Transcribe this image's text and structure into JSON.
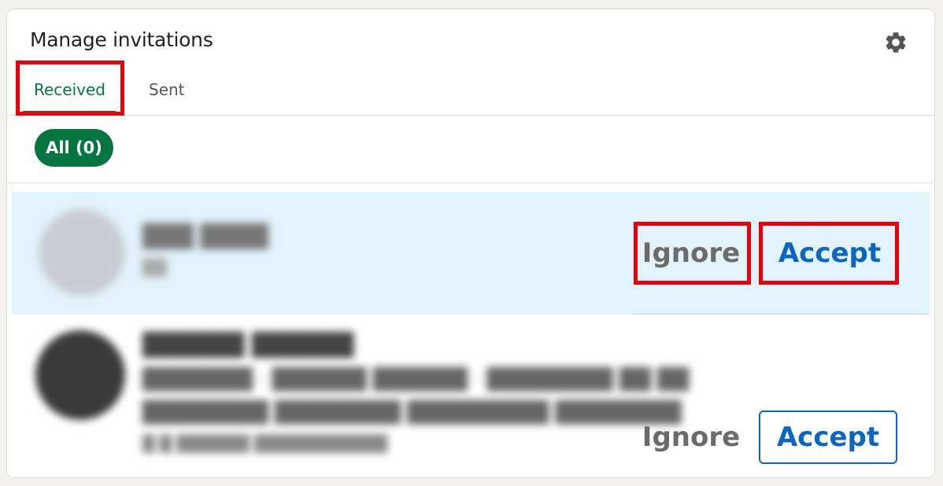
{
  "header": {
    "title": "Manage invitations",
    "settings_icon": "gear-icon"
  },
  "tabs": [
    {
      "label": "Received",
      "active": true
    },
    {
      "label": "Sent",
      "active": false
    }
  ],
  "filter": {
    "label": "All (0)"
  },
  "invitations": [
    {
      "ignore_label": "Ignore",
      "accept_label": "Accept",
      "highlighted": true
    },
    {
      "ignore_label": "Ignore",
      "accept_label": "Accept",
      "highlighted": false
    }
  ],
  "colors": {
    "accent_green": "#057642",
    "accept_blue": "#0a66c2",
    "highlight_red": "#e8000b",
    "row_highlight": "#e3f3fb"
  }
}
